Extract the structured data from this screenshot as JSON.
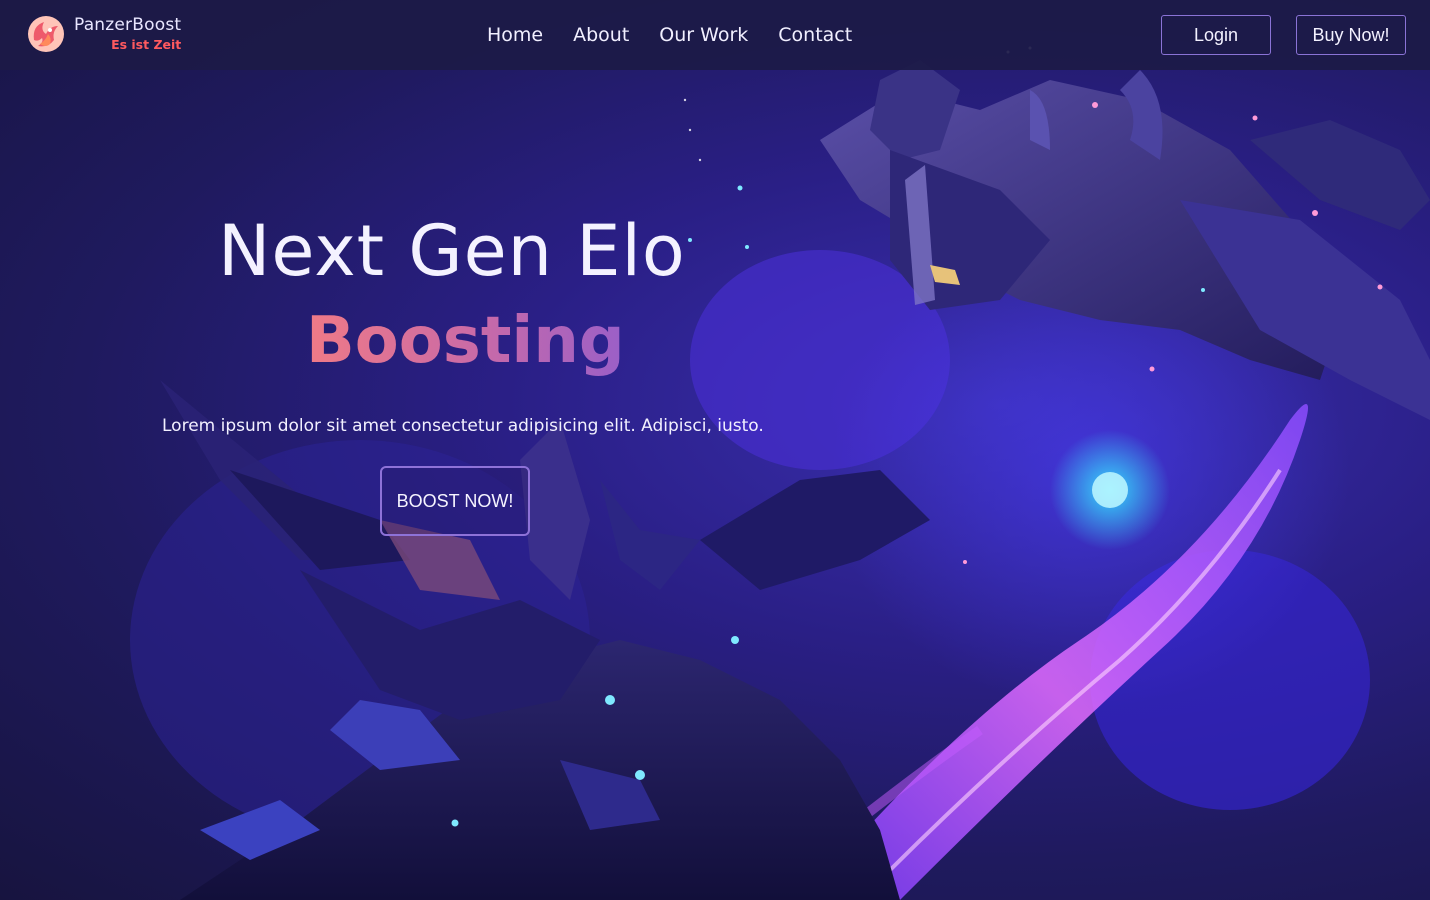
{
  "brand": {
    "name": "PanzerBoost",
    "tagline": "Es ist Zeit",
    "logo_icon": "phoenix-logo-icon"
  },
  "nav": {
    "links": [
      {
        "label": "Home"
      },
      {
        "label": "About"
      },
      {
        "label": "Our Work"
      },
      {
        "label": "Contact"
      }
    ],
    "login_label": "Login",
    "buy_label": "Buy Now!"
  },
  "hero": {
    "title": "Next Gen Elo",
    "accent": "Boosting",
    "subtitle": "Lorem ipsum dolor sit amet consectetur adipisicing elit. Adipisci, iusto.",
    "cta_label": "BOOST NOW!"
  },
  "colors": {
    "background": "#1f1a5e",
    "navbar": "#1c1a46",
    "accent_start": "#f07a86",
    "accent_end": "#9a5fc8",
    "tagline": "#ff5a5f",
    "button_border": "#8a73d6"
  }
}
